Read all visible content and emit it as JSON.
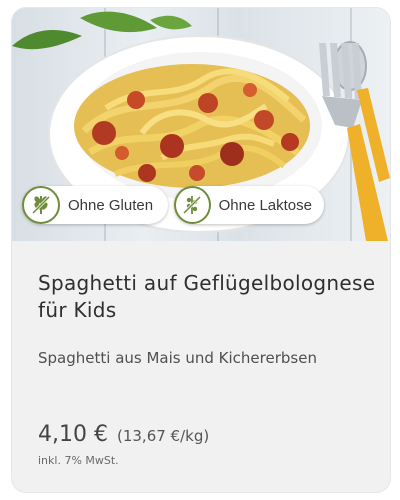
{
  "product": {
    "title": "Spaghetti auf Geflügelbolognese für Kids",
    "description": "Spaghetti aus Mais und Kichererbsen",
    "image_icon": "spaghetti-bolognese-photo"
  },
  "badges": [
    {
      "label": "Ohne Gluten",
      "icon": "wheat-crossed-icon"
    },
    {
      "label": "Ohne Laktose",
      "icon": "lactose-free-icon"
    }
  ],
  "pricing": {
    "price": "4,10 €",
    "unit_price": "(13,67 €/kg)",
    "tax_note": "inkl. 7% MwSt."
  },
  "colors": {
    "badge_icon_green": "#6f8c3a",
    "card_background": "#f1f1f1"
  }
}
